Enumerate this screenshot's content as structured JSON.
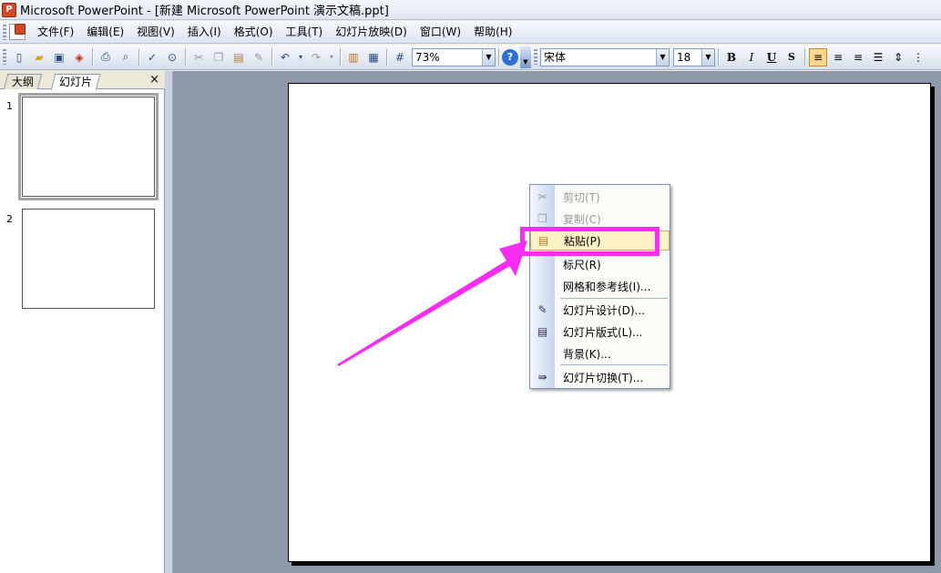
{
  "window": {
    "title": "Microsoft PowerPoint - [新建 Microsoft PowerPoint 演示文稿.ppt]",
    "app_icon": "powerpoint-icon"
  },
  "menu": {
    "items": [
      {
        "label": "文件(F)",
        "name": "menu-file"
      },
      {
        "label": "编辑(E)",
        "name": "menu-edit"
      },
      {
        "label": "视图(V)",
        "name": "menu-view"
      },
      {
        "label": "插入(I)",
        "name": "menu-insert"
      },
      {
        "label": "格式(O)",
        "name": "menu-format"
      },
      {
        "label": "工具(T)",
        "name": "menu-tools"
      },
      {
        "label": "幻灯片放映(D)",
        "name": "menu-slideshow"
      },
      {
        "label": "窗口(W)",
        "name": "menu-window"
      },
      {
        "label": "帮助(H)",
        "name": "menu-help"
      }
    ]
  },
  "toolbar": {
    "zoom_value": "73%",
    "font_name": "宋体",
    "font_size": "18",
    "bold": "B",
    "italic": "I",
    "underline": "U",
    "shadow": "S",
    "help": "?"
  },
  "outline_pane": {
    "tabs": [
      {
        "label": "大纲"
      },
      {
        "label": "幻灯片"
      }
    ],
    "close": "×",
    "thumbnails": [
      {
        "number": "1"
      },
      {
        "number": "2"
      }
    ]
  },
  "context_menu": {
    "items": [
      {
        "label": "剪切(T)",
        "icon": "scissors-icon",
        "disabled": true
      },
      {
        "label": "复制(C)",
        "icon": "copy-icon",
        "disabled": true
      },
      {
        "label": "粘贴(P)",
        "icon": "paste-icon",
        "disabled": false,
        "highlighted": true
      },
      {
        "label": "标尺(R)",
        "icon": "",
        "disabled": false
      },
      {
        "label": "网格和参考线(I)...",
        "icon": "",
        "disabled": false
      },
      {
        "label": "幻灯片设计(D)...",
        "icon": "slide-design-icon",
        "disabled": false
      },
      {
        "label": "幻灯片版式(L)...",
        "icon": "slide-layout-icon",
        "disabled": false
      },
      {
        "label": "背景(K)...",
        "icon": "",
        "disabled": false
      },
      {
        "label": "幻灯片切换(T)...",
        "icon": "slide-transition-icon",
        "disabled": false
      }
    ]
  },
  "colors": {
    "annotation": "#f72ef2",
    "menu_hover": "#fdf1c6"
  }
}
